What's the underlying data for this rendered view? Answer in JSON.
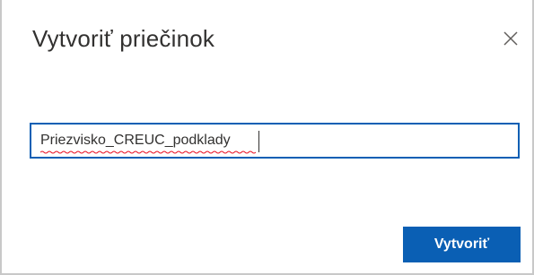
{
  "dialog": {
    "title": "Vytvoriť priečinok",
    "close_icon": "close-icon",
    "folder_name_input": {
      "value": "Priezvisko_CREUC_podklady",
      "spellcheck_error": true
    },
    "create_button_label": "Vytvoriť"
  },
  "colors": {
    "accent": "#0a5fb4",
    "title_text": "#323130",
    "border": "#c8c8c8",
    "spellcheck": "#e81123"
  }
}
